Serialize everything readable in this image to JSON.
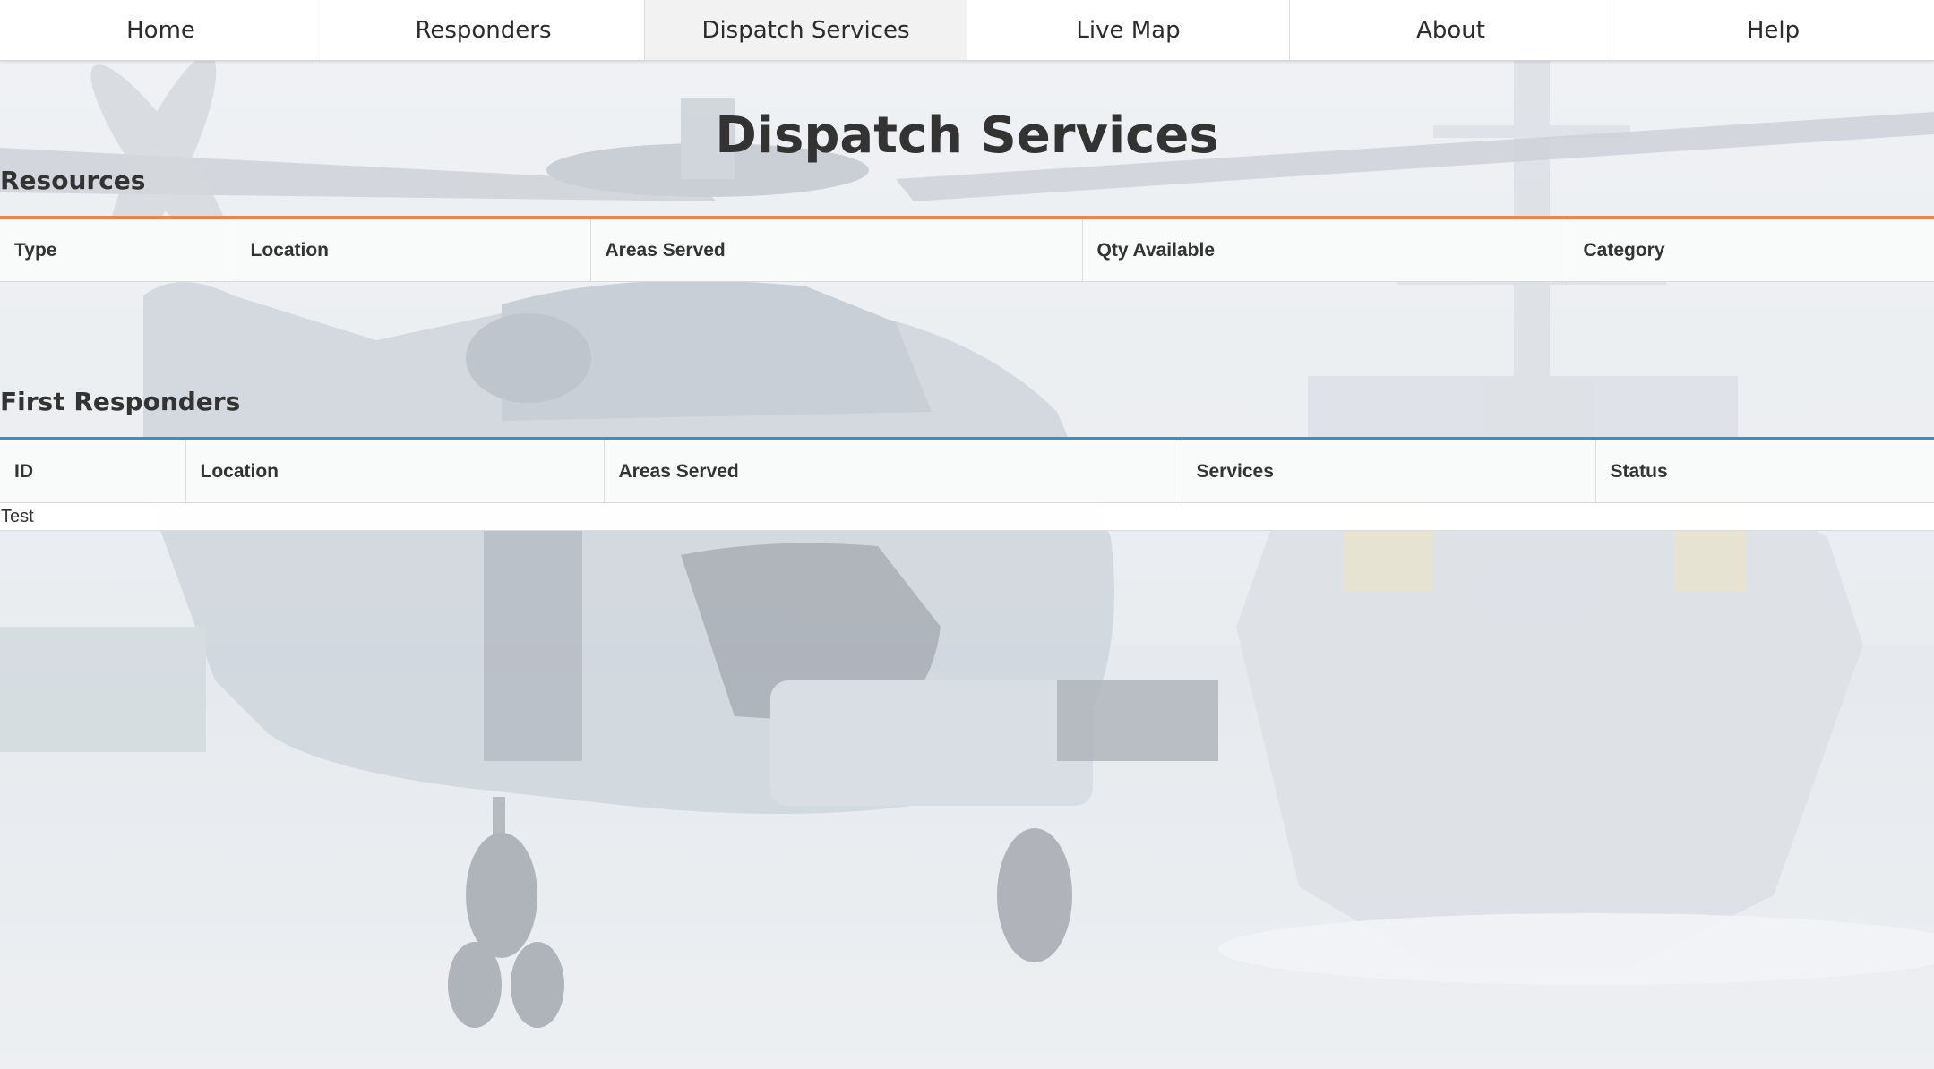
{
  "nav": {
    "items": [
      {
        "label": "Home",
        "active": false
      },
      {
        "label": "Responders",
        "active": false
      },
      {
        "label": "Dispatch Services",
        "active": true
      },
      {
        "label": "Live Map",
        "active": false
      },
      {
        "label": "About",
        "active": false
      },
      {
        "label": "Help",
        "active": false
      }
    ]
  },
  "page": {
    "title": "Dispatch Services"
  },
  "resources": {
    "title": "Resources",
    "accent_color": "#e7874a",
    "columns": [
      "Type",
      "Location",
      "Areas Served",
      "Qty Available",
      "Category"
    ],
    "rows": []
  },
  "first_responders": {
    "title": "First Responders",
    "accent_color": "#3c8dc5",
    "columns": [
      "ID",
      "Location",
      "Areas Served",
      "Services",
      "Status"
    ],
    "rows": [
      {
        "id": "Test"
      }
    ]
  },
  "background": {
    "description_icon": "helicopter-and-ship-photo"
  }
}
